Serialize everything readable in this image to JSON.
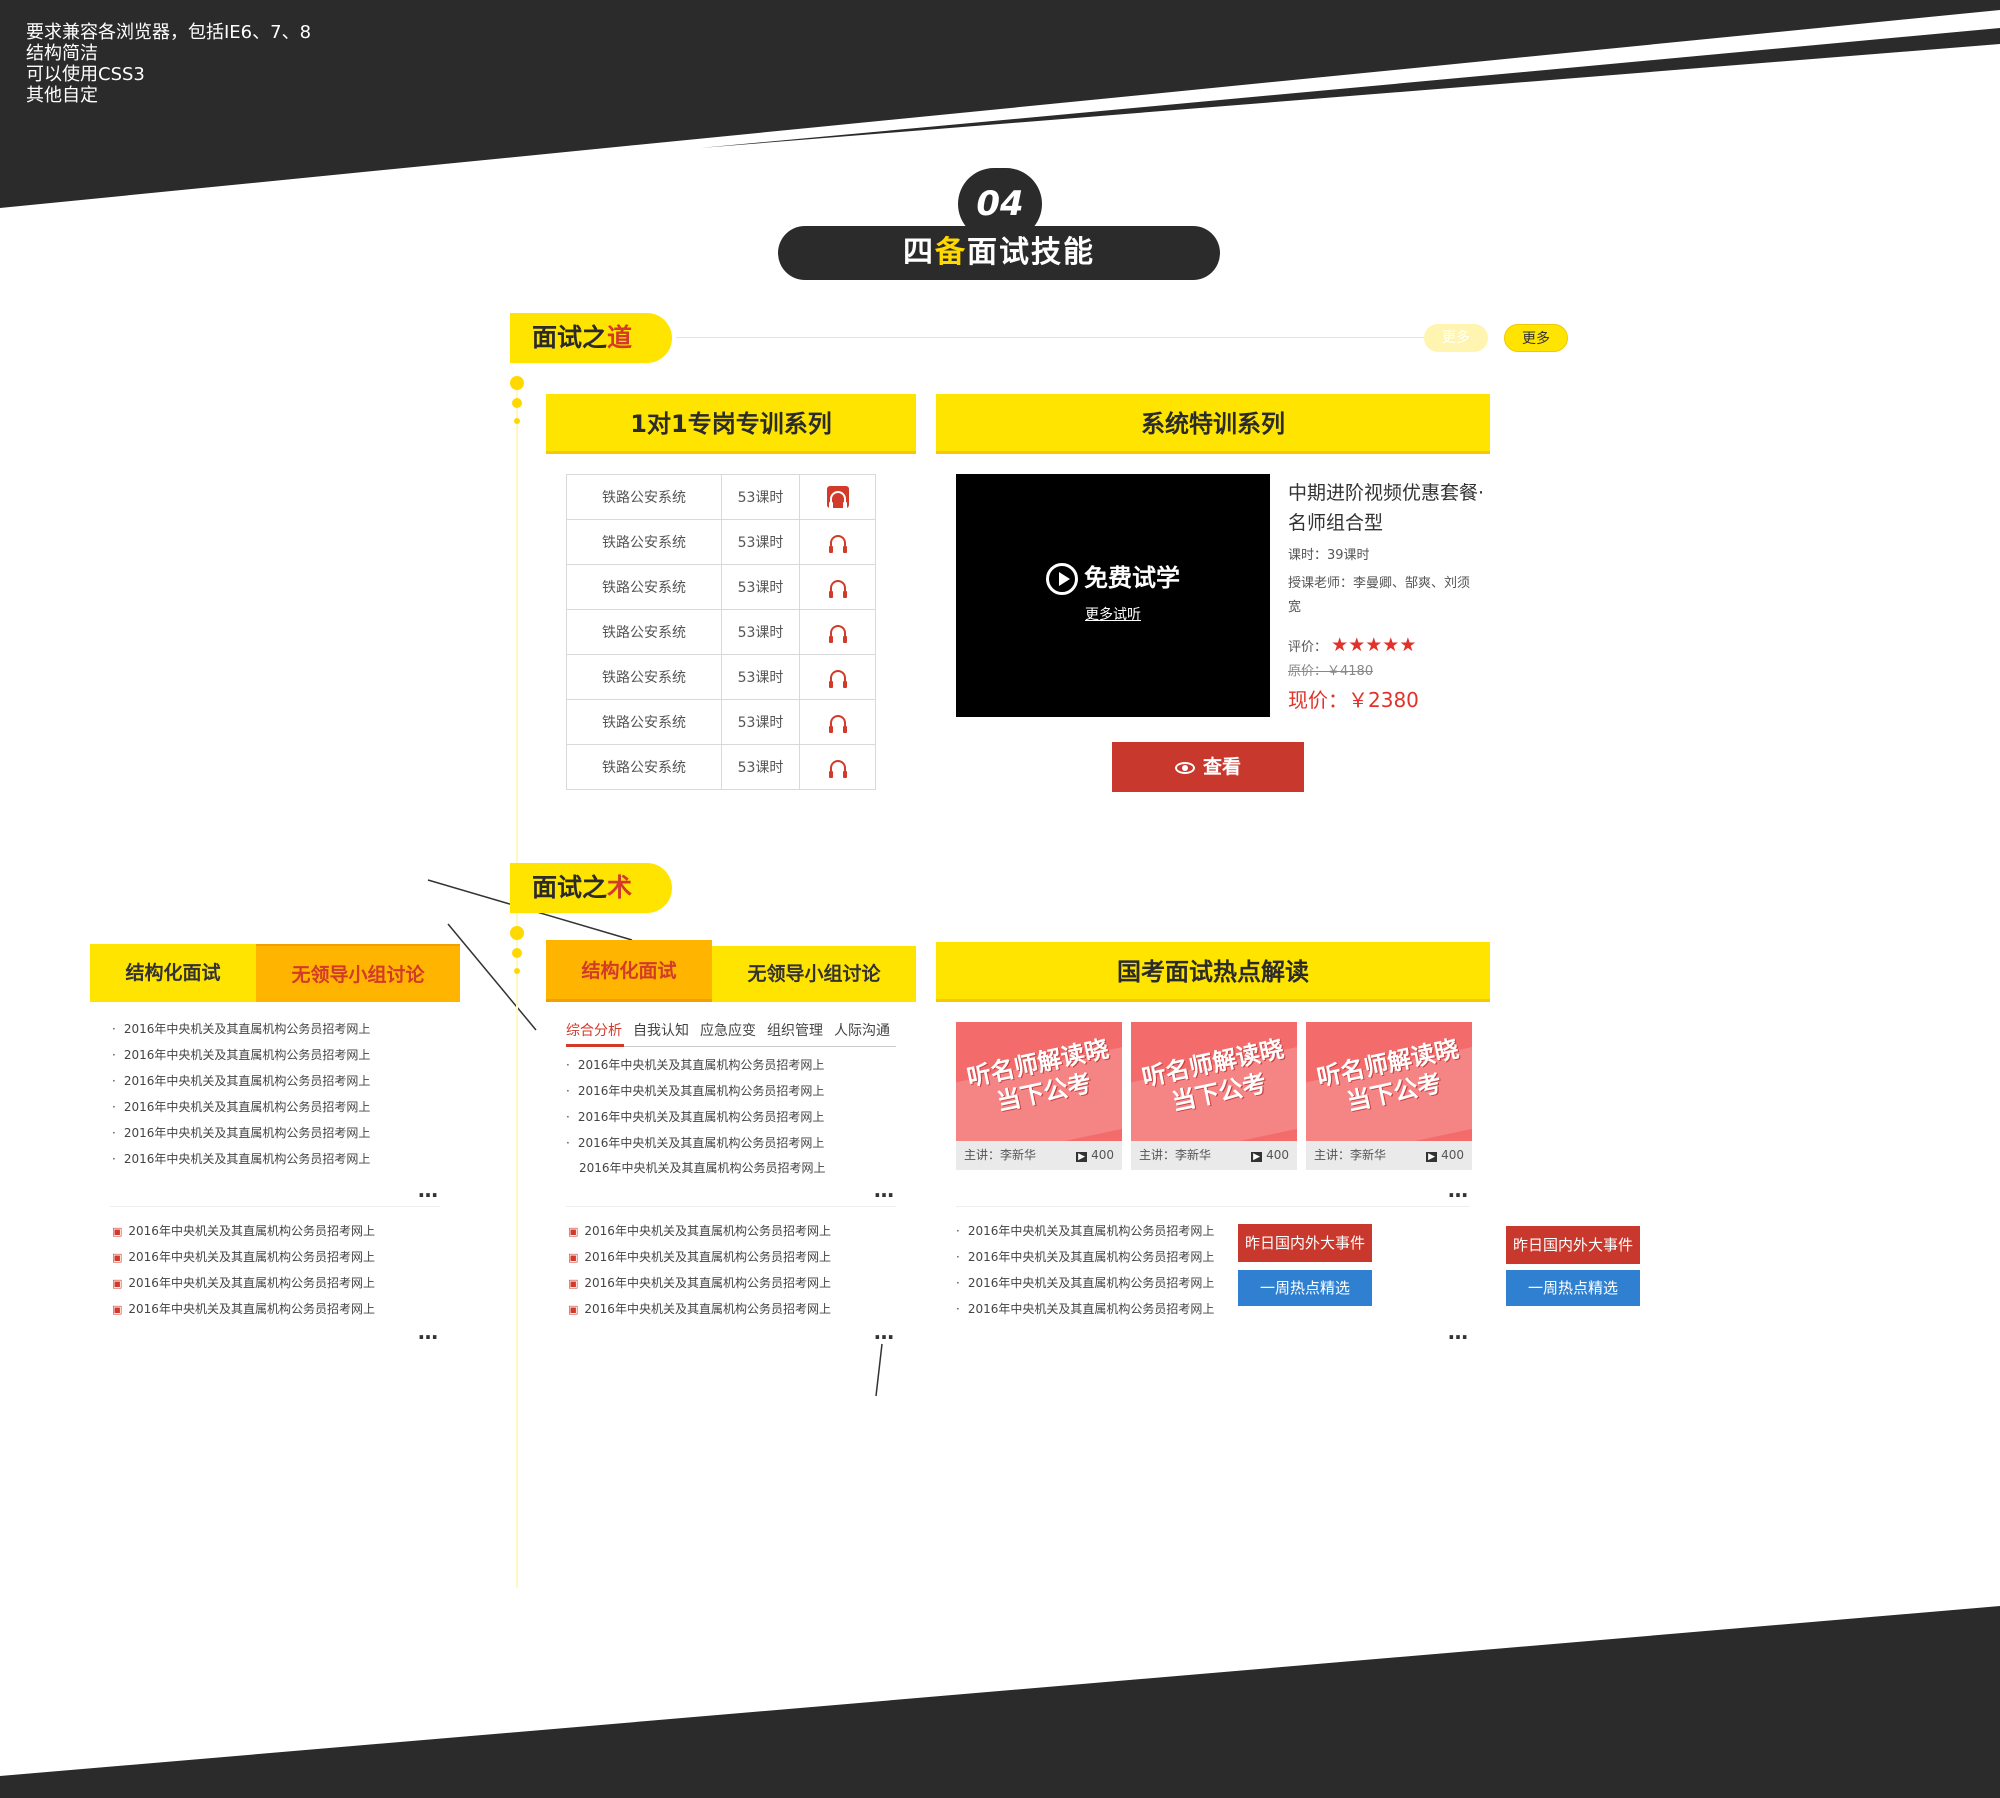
{
  "notes": [
    "要求兼容各浏览器，包括IE6、7、8",
    "结构简洁",
    "可以使用CSS3",
    "其他自定"
  ],
  "badge": {
    "number": "04",
    "title_a": "四",
    "title_b": "备",
    "title_c": "面试技能"
  },
  "sec1": {
    "tag_a": "面试之",
    "tag_b": "道",
    "more_ghost": "更多",
    "more": "更多"
  },
  "col1": {
    "title": "1对1专岗专训系列",
    "rows": [
      {
        "name": "铁路公安系统",
        "hours": "53课时"
      },
      {
        "name": "铁路公安系统",
        "hours": "53课时"
      },
      {
        "name": "铁路公安系统",
        "hours": "53课时"
      },
      {
        "name": "铁路公安系统",
        "hours": "53课时"
      },
      {
        "name": "铁路公安系统",
        "hours": "53课时"
      },
      {
        "name": "铁路公安系统",
        "hours": "53课时"
      },
      {
        "name": "铁路公安系统",
        "hours": "53课时"
      }
    ]
  },
  "col2": {
    "title": "系统特训系列",
    "video_label": "免费试学",
    "video_more": "更多试听",
    "course_title": "中期进阶视频优惠套餐·名师组合型",
    "hours": "课时：39课时",
    "teachers": "授课老师：李曼卿、郜爽、刘须宽",
    "rating_label": "评价：",
    "rating": 5,
    "price_old": "原价：￥4180",
    "price_now": "现价：￥2380",
    "view_btn": "查看"
  },
  "sec2": {
    "tag_a": "面试之",
    "tag_b": "术"
  },
  "left": {
    "tab1": "结构化面试",
    "tab2": "无领导小组讨论",
    "list1": [
      "2016年中央机关及其直属机构公务员招考网上",
      "2016年中央机关及其直属机构公务员招考网上",
      "2016年中央机关及其直属机构公务员招考网上",
      "2016年中央机关及其直属机构公务员招考网上",
      "2016年中央机关及其直属机构公务员招考网上",
      "2016年中央机关及其直属机构公务员招考网上"
    ],
    "list2": [
      "2016年中央机关及其直属机构公务员招考网上",
      "2016年中央机关及其直属机构公务员招考网上",
      "2016年中央机关及其直属机构公务员招考网上",
      "2016年中央机关及其直属机构公务员招考网上"
    ],
    "dots": "…"
  },
  "mid": {
    "tab1": "结构化面试",
    "tab2": "无领导小组讨论",
    "subtabs": [
      "综合分析",
      "自我认知",
      "应急应变",
      "组织管理",
      "人际沟通"
    ],
    "list1": [
      "2016年中央机关及其直属机构公务员招考网上",
      "2016年中央机关及其直属机构公务员招考网上",
      "2016年中央机关及其直属机构公务员招考网上",
      "2016年中央机关及其直属机构公务员招考网上"
    ],
    "list1_last": "2016年中央机关及其直属机构公务员招考网上",
    "list2": [
      "2016年中央机关及其直属机构公务员招考网上",
      "2016年中央机关及其直属机构公务员招考网上",
      "2016年中央机关及其直属机构公务员招考网上",
      "2016年中央机关及其直属机构公务员招考网上"
    ],
    "dots": "…"
  },
  "right": {
    "title": "国考面试热点解读",
    "cards": [
      {
        "text": "听名师解读晓当下公考",
        "host": "主讲：李新华",
        "count": "400"
      },
      {
        "text": "听名师解读晓当下公考",
        "host": "主讲：李新华",
        "count": "400"
      },
      {
        "text": "听名师解读晓当下公考",
        "host": "主讲：李新华",
        "count": "400"
      }
    ],
    "list": [
      "2016年中央机关及其直属机构公务员招考网上",
      "2016年中央机关及其直属机构公务员招考网上",
      "2016年中央机关及其直属机构公务员招考网上",
      "2016年中央机关及其直属机构公务员招考网上"
    ],
    "btn_red": "昨日国内外大事件",
    "btn_blue": "一周热点精选",
    "dots": "…"
  },
  "extra": {
    "btn_red": "昨日国内外大事件",
    "btn_blue": "一周热点精选"
  }
}
